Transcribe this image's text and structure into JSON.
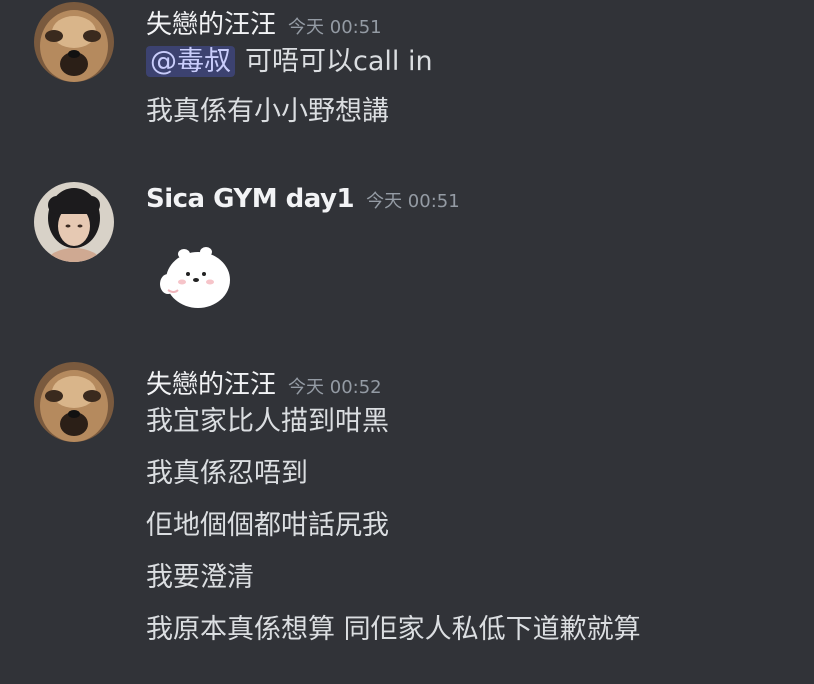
{
  "messages": [
    {
      "username": "失戀的汪汪",
      "timestamp": "今天 00:51",
      "mention": "@毒叔",
      "lines": [
        "可唔可以call in",
        "我真係有小小野想講"
      ]
    },
    {
      "username": "Sica GYM day1",
      "timestamp": "今天 00:51",
      "sticker": "white-bear-sticker"
    },
    {
      "username": "失戀的汪汪",
      "timestamp": "今天 00:52",
      "lines": [
        "我宜家比人描到咁黑",
        "我真係忍唔到",
        "佢地個個都咁話尻我",
        "我要澄清",
        "我原本真係想算 同佢家人私低下道歉就算"
      ]
    }
  ],
  "colors": {
    "background": "#313338",
    "username": "#f2f3f5",
    "timestamp": "#949ba4",
    "text": "#dbdee1",
    "mention_bg": "#3c4270",
    "mention_text": "#c9cdfb"
  },
  "icons": {
    "avatar_1": "dog-avatar",
    "avatar_2": "woman-avatar",
    "avatar_3": "dog-avatar"
  }
}
